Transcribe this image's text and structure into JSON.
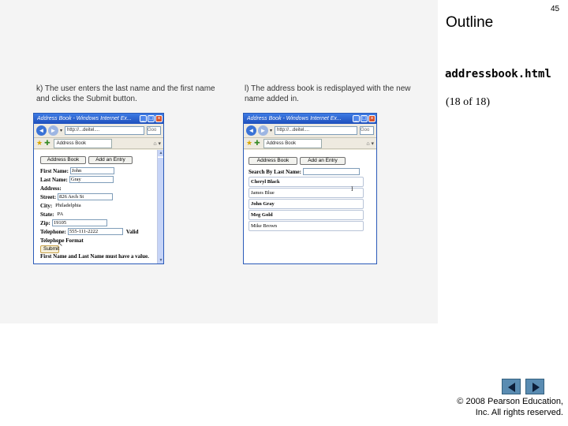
{
  "slide": {
    "outline_label": "Outline",
    "page_number": "45",
    "filename": "addressbook.html",
    "page_count": "(18 of 18)",
    "copyright_line1": "© 2008 Pearson Education,",
    "copyright_line2": "Inc.  All rights reserved.",
    "nav_prev_icon": "previous-arrow-icon",
    "nav_next_icon": "next-arrow-icon",
    "nav_color": "#5a8cb2"
  },
  "captions": {
    "a": "k) The user enters the last name and the first name and clicks the Submit button.",
    "b": "l) The address book is redisplayed with the new name added in."
  },
  "browser_a": {
    "title": "Address Book - Windows Internet Ex...",
    "address": "http://...deitel....",
    "search": "Goo",
    "tab": "Address Book",
    "buttons": [
      "Address Book",
      "Add an Entry"
    ],
    "fields": {
      "first_name_label": "First Name:",
      "first_name_value": "John",
      "last_name_label": "Last Name:",
      "last_name_value": "Gray",
      "address_label": "Address:",
      "street_label": "Street:",
      "street_value": "826 Arch St",
      "city_label": "City:",
      "city_value": "Philadelphia",
      "state_label": "State:",
      "state_value": "PA",
      "zip_label": "Zip:",
      "zip_value": "19105",
      "telephone_label": "Telephone:",
      "telephone_value": "555-111-2222",
      "valid_label": "Valid",
      "telephone_format": "Telephone Format",
      "submit_label": "Submit",
      "warning": "First Name and Last Name must have a value."
    }
  },
  "browser_b": {
    "title": "Address Book - Windows Internet Ex...",
    "address": "http://...deitel....",
    "search": "Goo",
    "tab": "Address Book",
    "buttons": [
      "Address Book",
      "Add an Entry"
    ],
    "search_label": "Search By Last Name:",
    "entries": [
      "Cheryl Black",
      "James Blue",
      "John Gray",
      "Meg Gold",
      "Mike Brown"
    ]
  }
}
